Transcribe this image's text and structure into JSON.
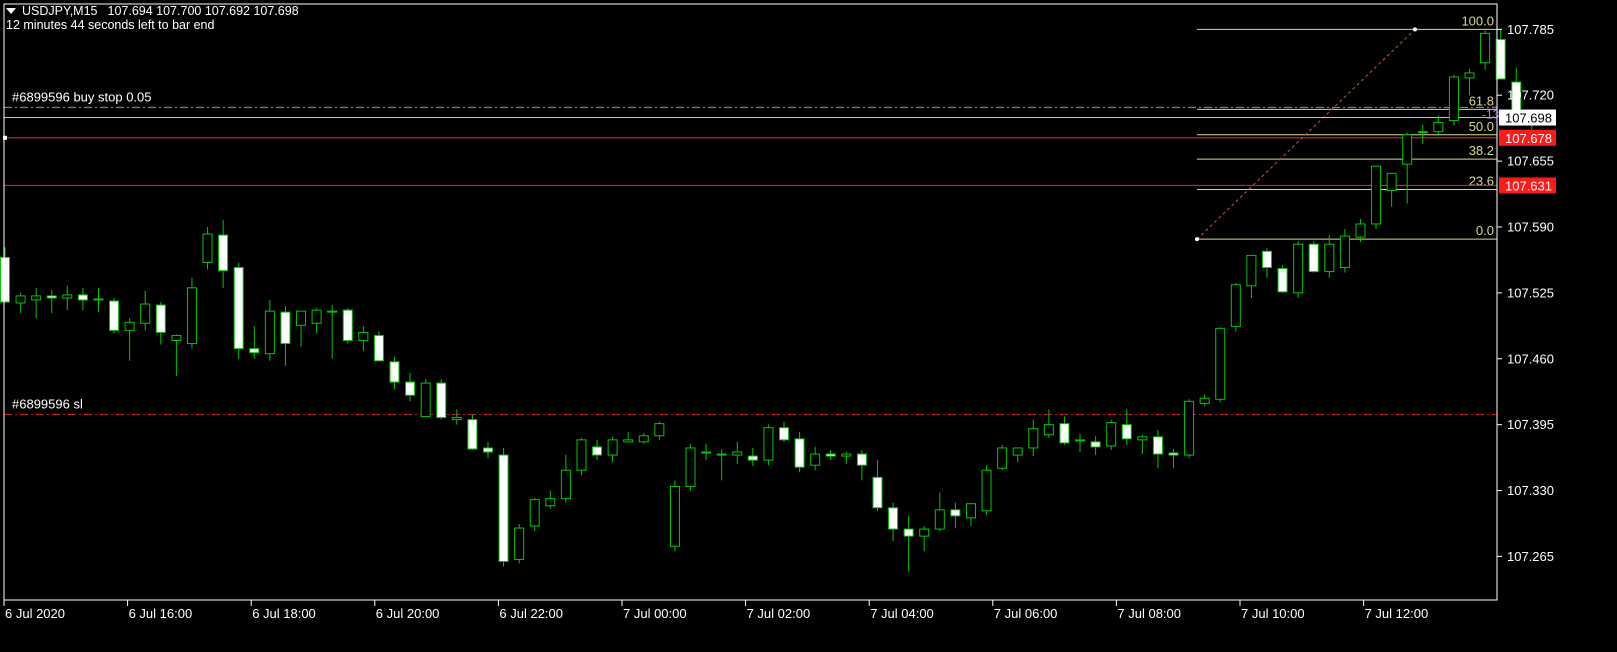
{
  "header": {
    "symbol": "USDJPY,M15",
    "ohlc": "107.694 107.700 107.692 107.698",
    "countdown": "12 minutes 44 seconds left to bar end"
  },
  "colors": {
    "background": "#000000",
    "frame": "#ffffff",
    "candle_line": "#00c800",
    "bull_body": "#000000",
    "bear_body": "#ffffff",
    "fibo": "#d8d890",
    "order_line": "#ff2020",
    "sl_line": "#c02020",
    "buy_stop_line": "#8a9a8a",
    "bid_line": "#c0c0c0",
    "price_tag_red": "#ff1a1a"
  },
  "orders": {
    "buy_stop_label": "#6899596 buy stop 0.05",
    "sl_label": "#6899596 sl"
  },
  "fibonacci": {
    "levels": [
      {
        "label": "100.0",
        "price": 107.785
      },
      {
        "label": "61.8",
        "price": 107.706
      },
      {
        "label": "50.0",
        "price": 107.681
      },
      {
        "label": "38.2",
        "price": 107.657
      },
      {
        "label": "23.6",
        "price": 107.627
      },
      {
        "label": "0.0",
        "price": 107.578
      }
    ],
    "anchor_low": 107.578,
    "anchor_high": 107.785
  },
  "price_tags": {
    "current": "107.698",
    "order1": "107.678",
    "order2": "107.631",
    "side_marker": "-13"
  },
  "chart_data": {
    "type": "candlestick",
    "symbol": "USDJPY",
    "timeframe": "M15",
    "ylim": [
      107.222,
      107.81
    ],
    "y_ticks": [
      "107.785",
      "107.720",
      "107.655",
      "107.590",
      "107.525",
      "107.460",
      "107.395",
      "107.330",
      "107.265"
    ],
    "x_ticks": [
      "6 Jul 2020",
      "6 Jul 16:00",
      "6 Jul 18:00",
      "6 Jul 20:00",
      "6 Jul 22:00",
      "7 Jul 00:00",
      "7 Jul 02:00",
      "7 Jul 04:00",
      "7 Jul 06:00",
      "7 Jul 08:00",
      "7 Jul 10:00",
      "7 Jul 12:00"
    ],
    "horizontal_lines": [
      {
        "name": "buy stop",
        "price": 107.708
      },
      {
        "name": "bid",
        "price": 107.698
      },
      {
        "name": "order 107.678",
        "price": 107.678
      },
      {
        "name": "order 107.631",
        "price": 107.631
      },
      {
        "name": "sl",
        "price": 107.405
      }
    ],
    "candles": [
      [
        107.56,
        107.57,
        107.515,
        107.516
      ],
      [
        107.515,
        107.525,
        107.505,
        107.522
      ],
      [
        107.518,
        107.53,
        107.5,
        107.522
      ],
      [
        107.522,
        107.528,
        107.505,
        107.52
      ],
      [
        107.52,
        107.532,
        107.508,
        107.523
      ],
      [
        107.523,
        107.53,
        107.508,
        107.518
      ],
      [
        107.518,
        107.53,
        107.506,
        107.519
      ],
      [
        107.517,
        107.52,
        107.485,
        107.488
      ],
      [
        107.488,
        107.5,
        107.458,
        107.496
      ],
      [
        107.495,
        107.527,
        107.488,
        107.514
      ],
      [
        107.513,
        107.516,
        107.474,
        107.486
      ],
      [
        107.478,
        107.484,
        107.443,
        107.483
      ],
      [
        107.475,
        107.54,
        107.47,
        107.53
      ],
      [
        107.555,
        107.59,
        107.548,
        107.583
      ],
      [
        107.582,
        107.597,
        107.53,
        107.547
      ],
      [
        107.55,
        107.555,
        107.46,
        107.47
      ],
      [
        107.47,
        107.492,
        107.46,
        107.466
      ],
      [
        107.465,
        107.518,
        107.458,
        107.507
      ],
      [
        107.506,
        107.512,
        107.453,
        107.475
      ],
      [
        107.493,
        107.503,
        107.472,
        107.507
      ],
      [
        107.495,
        107.51,
        107.485,
        107.508
      ],
      [
        107.506,
        107.513,
        107.46,
        107.507
      ],
      [
        107.508,
        107.51,
        107.475,
        107.478
      ],
      [
        107.478,
        107.492,
        107.468,
        107.486
      ],
      [
        107.483,
        107.487,
        107.458,
        107.458
      ],
      [
        107.457,
        107.462,
        107.43,
        107.437
      ],
      [
        107.437,
        107.446,
        107.418,
        107.424
      ],
      [
        107.403,
        107.44,
        107.404,
        107.436
      ],
      [
        107.436,
        107.44,
        107.4,
        107.402
      ],
      [
        107.4,
        107.41,
        107.395,
        107.402
      ],
      [
        107.4,
        107.405,
        107.37,
        107.371
      ],
      [
        107.372,
        107.378,
        107.362,
        107.368
      ],
      [
        107.365,
        107.372,
        107.255,
        107.26
      ],
      [
        107.262,
        107.297,
        107.258,
        107.293
      ],
      [
        107.295,
        107.323,
        107.29,
        107.321
      ],
      [
        107.315,
        107.33,
        107.312,
        107.322
      ],
      [
        107.322,
        107.365,
        107.318,
        107.35
      ],
      [
        107.35,
        107.382,
        107.345,
        107.38
      ],
      [
        107.373,
        107.38,
        107.36,
        107.365
      ],
      [
        107.365,
        107.383,
        107.358,
        107.38
      ],
      [
        107.378,
        107.388,
        107.378,
        107.38
      ],
      [
        107.378,
        107.387,
        107.376,
        107.384
      ],
      [
        107.384,
        107.398,
        107.38,
        107.396
      ],
      [
        107.275,
        107.34,
        107.27,
        107.334
      ],
      [
        107.334,
        107.376,
        107.33,
        107.372
      ],
      [
        107.368,
        107.376,
        107.36,
        107.368
      ],
      [
        107.366,
        107.371,
        107.34,
        107.365
      ],
      [
        107.365,
        107.378,
        107.356,
        107.368
      ],
      [
        107.364,
        107.372,
        107.354,
        107.36
      ],
      [
        107.36,
        107.395,
        107.355,
        107.392
      ],
      [
        107.392,
        107.398,
        107.378,
        107.38
      ],
      [
        107.381,
        107.388,
        107.348,
        107.353
      ],
      [
        107.355,
        107.373,
        107.35,
        107.366
      ],
      [
        107.366,
        107.37,
        107.36,
        107.364
      ],
      [
        107.364,
        107.368,
        107.356,
        107.366
      ],
      [
        107.366,
        107.37,
        107.34,
        107.355
      ],
      [
        107.343,
        107.36,
        107.31,
        107.313
      ],
      [
        107.313,
        107.318,
        107.28,
        107.292
      ],
      [
        107.292,
        107.305,
        107.25,
        107.285
      ],
      [
        107.285,
        107.295,
        107.27,
        107.292
      ],
      [
        107.292,
        107.328,
        107.29,
        107.311
      ],
      [
        107.311,
        107.318,
        107.293,
        107.305
      ],
      [
        107.303,
        107.315,
        107.295,
        107.317
      ],
      [
        107.31,
        107.355,
        107.306,
        107.35
      ],
      [
        107.352,
        107.375,
        107.35,
        107.372
      ],
      [
        107.365,
        107.372,
        107.358,
        107.372
      ],
      [
        107.372,
        107.4,
        107.364,
        107.391
      ],
      [
        107.385,
        107.41,
        107.382,
        107.395
      ],
      [
        107.396,
        107.403,
        107.375,
        107.377
      ],
      [
        107.38,
        107.386,
        107.368,
        107.38
      ],
      [
        107.378,
        107.384,
        107.365,
        107.373
      ],
      [
        107.374,
        107.4,
        107.37,
        107.397
      ],
      [
        107.395,
        107.41,
        107.375,
        107.381
      ],
      [
        107.38,
        107.385,
        107.366,
        107.383
      ],
      [
        107.383,
        107.39,
        107.352,
        107.366
      ],
      [
        107.367,
        107.371,
        107.352,
        107.365
      ],
      [
        107.365,
        107.42,
        107.362,
        107.418
      ],
      [
        107.416,
        107.425,
        107.413,
        107.421
      ],
      [
        107.42,
        107.491,
        107.417,
        107.49
      ],
      [
        107.492,
        107.535,
        107.487,
        107.533
      ],
      [
        107.532,
        107.56,
        107.52,
        107.562
      ],
      [
        107.566,
        107.569,
        107.54,
        107.55
      ],
      [
        107.549,
        107.552,
        107.525,
        107.526
      ],
      [
        107.525,
        107.576,
        107.52,
        107.573
      ],
      [
        107.573,
        107.576,
        107.545,
        107.546
      ],
      [
        107.546,
        107.582,
        107.54,
        107.573
      ],
      [
        107.55,
        107.588,
        107.545,
        107.581
      ],
      [
        107.58,
        107.598,
        107.575,
        107.593
      ],
      [
        107.593,
        107.65,
        107.588,
        107.65
      ],
      [
        107.626,
        107.643,
        107.61,
        107.643
      ],
      [
        107.652,
        107.683,
        107.613,
        107.681
      ],
      [
        107.684,
        107.691,
        107.672,
        107.684
      ],
      [
        107.684,
        107.7,
        107.68,
        107.693
      ],
      [
        107.695,
        107.74,
        107.69,
        107.738
      ],
      [
        107.737,
        107.746,
        107.72,
        107.742
      ],
      [
        107.752,
        107.784,
        107.745,
        107.781
      ],
      [
        107.775,
        107.785,
        107.736,
        107.736
      ],
      [
        107.733,
        107.747,
        107.69,
        107.693
      ],
      [
        107.693,
        107.7,
        107.672,
        107.696
      ],
      [
        107.694,
        107.7,
        107.692,
        107.698
      ]
    ]
  }
}
